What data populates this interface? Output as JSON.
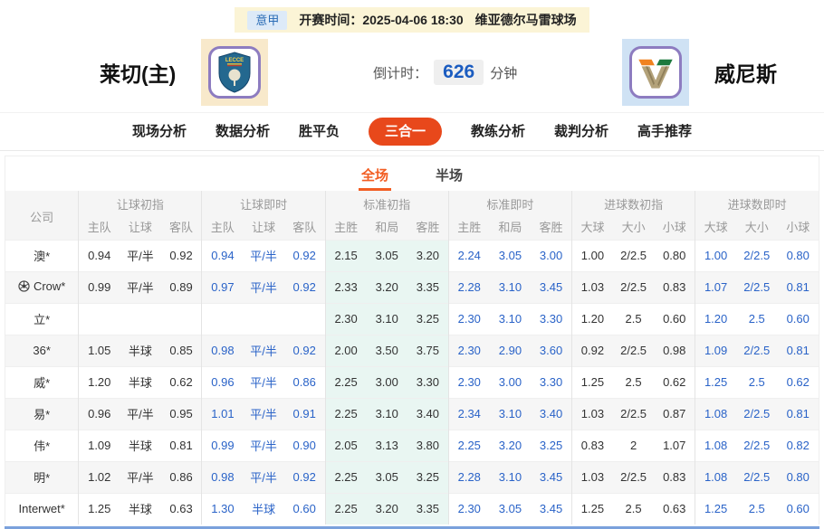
{
  "colors": {
    "accent": "#e8481b",
    "subtab": "#f25d22",
    "live": "#2a63c8",
    "mint": "#e9f6f2",
    "count": "#1b5cc0",
    "topbarBg": "#fbf4d6",
    "badgeBg": "#ddeaf8",
    "badgeFg": "#2a6cb5"
  },
  "top_bar": {
    "league": "意甲",
    "kickoff": "开赛时间：2025-04-06 18:30",
    "venue": "维亚德尔马雷球场"
  },
  "match": {
    "home_name": "莱切(主)",
    "away_name": "威尼斯",
    "countdown_label": "倒计时：",
    "countdown_value": "626",
    "countdown_unit": "分钟",
    "home_logo": "lecce-crest",
    "away_logo": "venezia-crest"
  },
  "nav": {
    "items": [
      {
        "label": "现场分析",
        "active": false
      },
      {
        "label": "数据分析",
        "active": false
      },
      {
        "label": "胜平负",
        "active": false
      },
      {
        "label": "三合一",
        "active": true
      },
      {
        "label": "教练分析",
        "active": false
      },
      {
        "label": "裁判分析",
        "active": false
      },
      {
        "label": "高手推荐",
        "active": false
      }
    ]
  },
  "period_tabs": {
    "items": [
      {
        "label": "全场",
        "active": true
      },
      {
        "label": "半场",
        "active": false
      }
    ]
  },
  "table": {
    "company_header": "公司",
    "groups": [
      {
        "label": "让球初指",
        "cols": [
          "主队",
          "让球",
          "客队"
        ],
        "live": false,
        "tint": false
      },
      {
        "label": "让球即时",
        "cols": [
          "主队",
          "让球",
          "客队"
        ],
        "live": true,
        "tint": false
      },
      {
        "label": "标准初指",
        "cols": [
          "主胜",
          "和局",
          "客胜"
        ],
        "live": false,
        "tint": true
      },
      {
        "label": "标准即时",
        "cols": [
          "主胜",
          "和局",
          "客胜"
        ],
        "live": true,
        "tint": false
      },
      {
        "label": "进球数初指",
        "cols": [
          "大球",
          "大小",
          "小球"
        ],
        "live": false,
        "tint": false
      },
      {
        "label": "进球数即时",
        "cols": [
          "大球",
          "大小",
          "小球"
        ],
        "live": true,
        "tint": false
      }
    ],
    "rows": [
      {
        "company": "澳*",
        "icon": false,
        "cells": [
          [
            "0.94",
            "平/半",
            "0.92"
          ],
          [
            "0.94",
            "平/半",
            "0.92"
          ],
          [
            "2.15",
            "3.05",
            "3.20"
          ],
          [
            "2.24",
            "3.05",
            "3.00"
          ],
          [
            "1.00",
            "2/2.5",
            "0.80"
          ],
          [
            "1.00",
            "2/2.5",
            "0.80"
          ]
        ]
      },
      {
        "company": "Crow*",
        "icon": true,
        "cells": [
          [
            "0.99",
            "平/半",
            "0.89"
          ],
          [
            "0.97",
            "平/半",
            "0.92"
          ],
          [
            "2.33",
            "3.20",
            "3.35"
          ],
          [
            "2.28",
            "3.10",
            "3.45"
          ],
          [
            "1.03",
            "2/2.5",
            "0.83"
          ],
          [
            "1.07",
            "2/2.5",
            "0.81"
          ]
        ]
      },
      {
        "company": "立*",
        "icon": false,
        "cells": [
          [
            "",
            "",
            ""
          ],
          [
            "",
            "",
            ""
          ],
          [
            "2.30",
            "3.10",
            "3.25"
          ],
          [
            "2.30",
            "3.10",
            "3.30"
          ],
          [
            "1.20",
            "2.5",
            "0.60"
          ],
          [
            "1.20",
            "2.5",
            "0.60"
          ]
        ]
      },
      {
        "company": "36*",
        "icon": false,
        "cells": [
          [
            "1.05",
            "半球",
            "0.85"
          ],
          [
            "0.98",
            "平/半",
            "0.92"
          ],
          [
            "2.00",
            "3.50",
            "3.75"
          ],
          [
            "2.30",
            "2.90",
            "3.60"
          ],
          [
            "0.92",
            "2/2.5",
            "0.98"
          ],
          [
            "1.09",
            "2/2.5",
            "0.81"
          ]
        ]
      },
      {
        "company": "威*",
        "icon": false,
        "cells": [
          [
            "1.20",
            "半球",
            "0.62"
          ],
          [
            "0.96",
            "平/半",
            "0.86"
          ],
          [
            "2.25",
            "3.00",
            "3.30"
          ],
          [
            "2.30",
            "3.00",
            "3.30"
          ],
          [
            "1.25",
            "2.5",
            "0.62"
          ],
          [
            "1.25",
            "2.5",
            "0.62"
          ]
        ]
      },
      {
        "company": "易*",
        "icon": false,
        "cells": [
          [
            "0.96",
            "平/半",
            "0.95"
          ],
          [
            "1.01",
            "平/半",
            "0.91"
          ],
          [
            "2.25",
            "3.10",
            "3.40"
          ],
          [
            "2.34",
            "3.10",
            "3.40"
          ],
          [
            "1.03",
            "2/2.5",
            "0.87"
          ],
          [
            "1.08",
            "2/2.5",
            "0.81"
          ]
        ]
      },
      {
        "company": "伟*",
        "icon": false,
        "cells": [
          [
            "1.09",
            "半球",
            "0.81"
          ],
          [
            "0.99",
            "平/半",
            "0.90"
          ],
          [
            "2.05",
            "3.13",
            "3.80"
          ],
          [
            "2.25",
            "3.20",
            "3.25"
          ],
          [
            "0.83",
            "2",
            "1.07"
          ],
          [
            "1.08",
            "2/2.5",
            "0.82"
          ]
        ]
      },
      {
        "company": "明*",
        "icon": false,
        "cells": [
          [
            "1.02",
            "平/半",
            "0.86"
          ],
          [
            "0.98",
            "平/半",
            "0.92"
          ],
          [
            "2.25",
            "3.05",
            "3.25"
          ],
          [
            "2.28",
            "3.10",
            "3.45"
          ],
          [
            "1.03",
            "2/2.5",
            "0.83"
          ],
          [
            "1.08",
            "2/2.5",
            "0.80"
          ]
        ]
      },
      {
        "company": "Interwet*",
        "icon": false,
        "cells": [
          [
            "1.25",
            "半球",
            "0.63"
          ],
          [
            "1.30",
            "半球",
            "0.60"
          ],
          [
            "2.25",
            "3.20",
            "3.35"
          ],
          [
            "2.30",
            "3.05",
            "3.45"
          ],
          [
            "1.25",
            "2.5",
            "0.63"
          ],
          [
            "1.25",
            "2.5",
            "0.60"
          ]
        ]
      }
    ]
  }
}
